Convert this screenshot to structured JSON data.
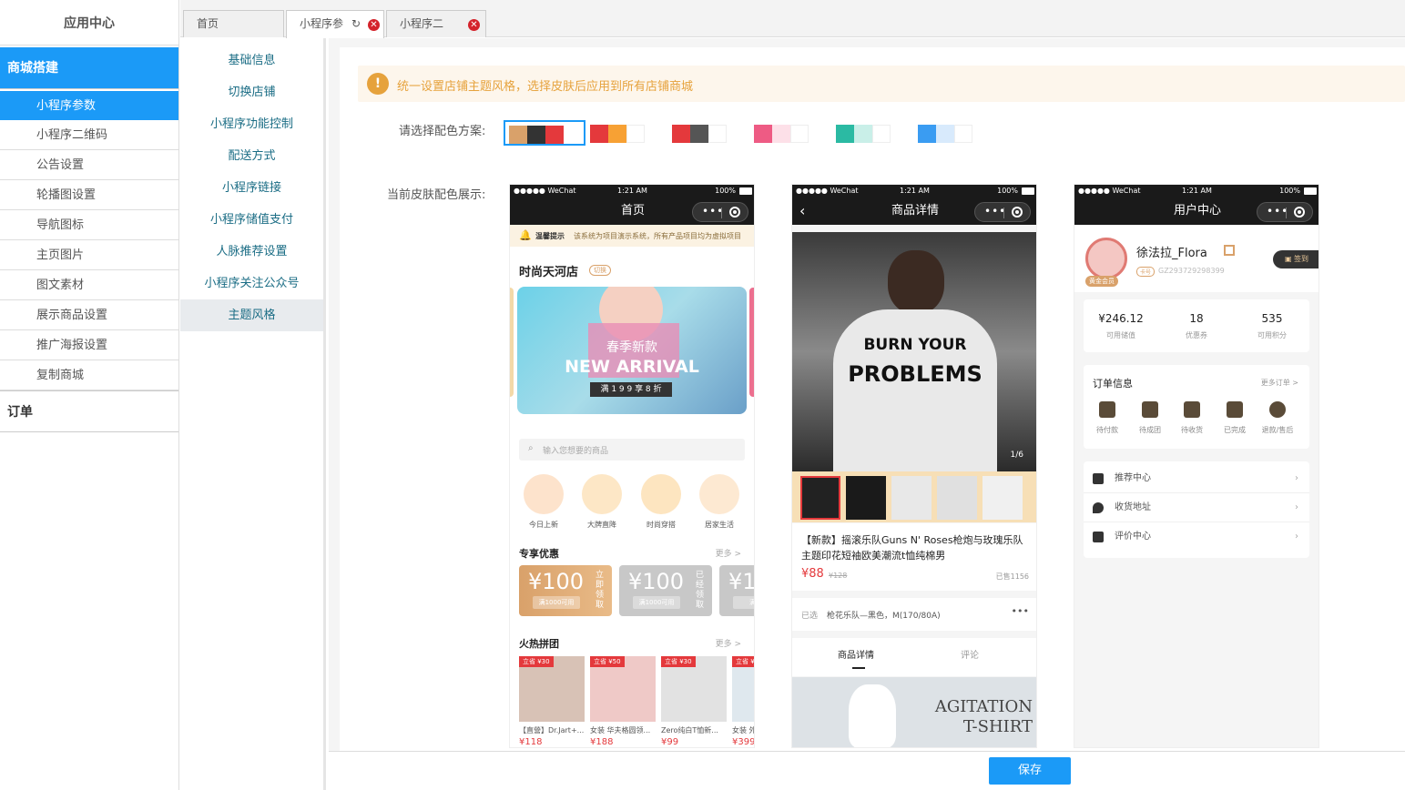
{
  "sidebar": {
    "app_center": "应用中心",
    "group_mall": "商城搭建",
    "items": [
      {
        "label": "小程序参数"
      },
      {
        "label": "小程序二维码"
      },
      {
        "label": "公告设置"
      },
      {
        "label": "轮播图设置"
      },
      {
        "label": "导航图标"
      },
      {
        "label": "主页图片"
      },
      {
        "label": "图文素材"
      },
      {
        "label": "展示商品设置"
      },
      {
        "label": "推广海报设置"
      },
      {
        "label": "复制商城"
      }
    ],
    "group_order": "订单"
  },
  "tabs": [
    {
      "label": "首页"
    },
    {
      "label": "小程序参"
    },
    {
      "label": "小程序二"
    }
  ],
  "submenu": {
    "items": [
      {
        "label": "基础信息"
      },
      {
        "label": "切换店铺"
      },
      {
        "label": "小程序功能控制"
      },
      {
        "label": "配送方式"
      },
      {
        "label": "小程序链接"
      },
      {
        "label": "小程序储值支付"
      },
      {
        "label": "人脉推荐设置"
      },
      {
        "label": "小程序关注公众号"
      },
      {
        "label": "主题风格"
      }
    ]
  },
  "notice": {
    "icon": "!",
    "text": "统一设置店铺主题风格，选择皮肤后应用到所有店铺商城"
  },
  "scheme": {
    "label": "请选择配色方案:",
    "options": [
      {
        "colors": [
          "#d9a16a",
          "#333333",
          "#e4393c"
        ]
      },
      {
        "colors": [
          "#e4393c",
          "#f7a134",
          "#ffffff"
        ]
      },
      {
        "colors": [
          "#e4393c",
          "#555555",
          "#ffffff"
        ]
      },
      {
        "colors": [
          "#ee5b84",
          "#fde0e8",
          "#ffffff"
        ]
      },
      {
        "colors": [
          "#2bbaa3",
          "#c9efe8",
          "#ffffff"
        ]
      },
      {
        "colors": [
          "#3a9cf2",
          "#d8eafc",
          "#ffffff"
        ]
      }
    ]
  },
  "preview": {
    "label": "当前皮肤配色展示:",
    "status_carrier": "●●●●● WeChat",
    "status_time": "1:21 AM",
    "status_battery": "100%",
    "home": {
      "title": "首页",
      "notice_label": "温馨提示",
      "notice_text": "该系统为项目演示系统，所有产品项目均为虚拟项目",
      "shop_name": "时尚天河店",
      "switch_tag": "切换",
      "banner_cn": "春季新款",
      "banner_en": "NEW ARRIVAL",
      "banner_sub": "满 1 9 9 享 8 折",
      "search_placeholder": "输入您想要的商品",
      "categories": [
        {
          "label": "今日上新"
        },
        {
          "label": "大牌直降"
        },
        {
          "label": "时尚穿搭"
        },
        {
          "label": "居家生活"
        }
      ],
      "discount_title": "专享优惠",
      "more": "更多 >",
      "coupons": [
        {
          "amount": "¥100",
          "cond": "满1000可用",
          "action": "立即领取"
        },
        {
          "amount": "¥100",
          "cond": "满1000可用",
          "action": "已经领取"
        },
        {
          "amount": "¥1",
          "cond": "满10",
          "action": ""
        }
      ],
      "group_title": "火热拼团",
      "groups": [
        {
          "tag": "立省 ¥30",
          "name": "【直營】Dr.Jart+...",
          "price": "¥118"
        },
        {
          "tag": "立省 ¥50",
          "name": "女装 华夫格圆领...",
          "price": "¥188"
        },
        {
          "tag": "立省 ¥30",
          "name": "Zero纯白T恤新...",
          "price": "¥99"
        },
        {
          "tag": "立省 ¥",
          "name": "女装 外",
          "price": "¥399"
        }
      ]
    },
    "detail": {
      "title": "商品详情",
      "image_index": "1/6",
      "shirt_text_1": "BURN YOUR",
      "shirt_text_2": "PROBLEMS",
      "product_name": "【新款】摇滚乐队Guns N' Roses枪炮与玫瑰乐队主题印花短袖欧美潮流t恤纯棉男",
      "price": "¥88",
      "old_price": "¥128",
      "sold": "已售1156",
      "selected_label": "已选",
      "selected_value": "枪花乐队—黑色，M(170/80A)",
      "tab_detail": "商品详情",
      "tab_review": "评论",
      "banner_text_1": "AGITATION",
      "banner_text_2": "T-SHIRT"
    },
    "user": {
      "title": "用户中心",
      "name": "徐法拉_Flora",
      "level_tag": "卡号",
      "card_no": "GZ293729298399",
      "vip": "黄金会员",
      "sign": "签到",
      "stats": [
        {
          "value": "¥246.12",
          "label": "可用储值"
        },
        {
          "value": "18",
          "label": "优惠券"
        },
        {
          "value": "535",
          "label": "可用积分"
        }
      ],
      "order_title": "订单信息",
      "order_more": "更多订单 >",
      "orders": [
        {
          "label": "待付款"
        },
        {
          "label": "待成团"
        },
        {
          "label": "待收货"
        },
        {
          "label": "已完成"
        },
        {
          "label": "退款/售后"
        }
      ],
      "menus": [
        {
          "label": "推荐中心"
        },
        {
          "label": "收货地址"
        },
        {
          "label": "评价中心"
        }
      ]
    }
  },
  "footer": {
    "save": "保存"
  }
}
